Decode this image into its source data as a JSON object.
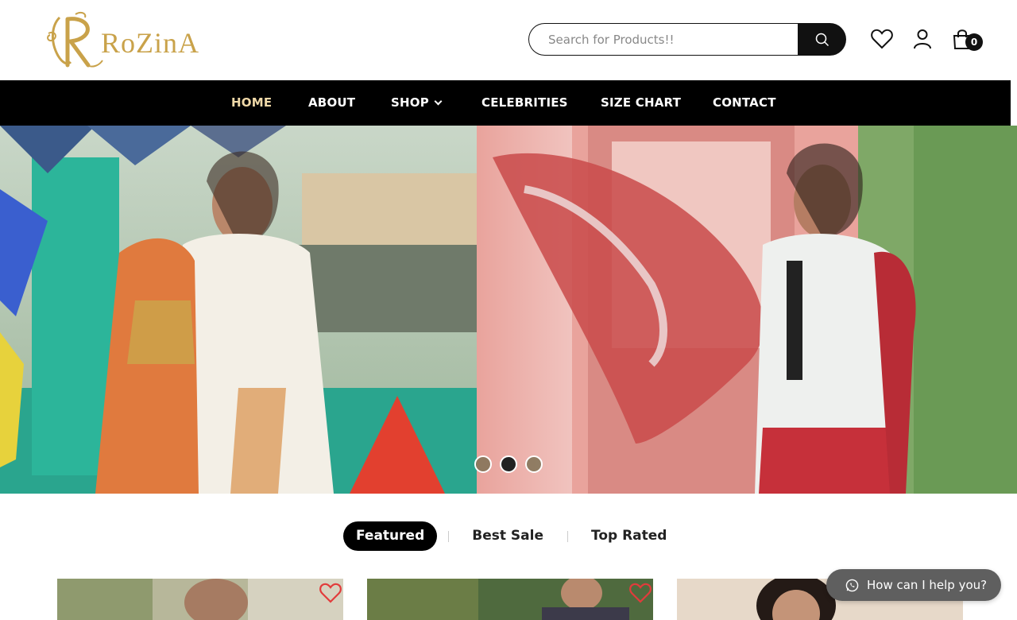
{
  "brand": {
    "name": "RoZinA",
    "accent": "#c9a24a"
  },
  "search": {
    "placeholder": "Search for Products!!"
  },
  "header": {
    "cart_count": "0",
    "icons": [
      "heart-icon",
      "user-icon",
      "bag-icon"
    ]
  },
  "nav": {
    "items": [
      "HOME",
      "ABOUT",
      "SHOP",
      "CELEBRITIES",
      "SIZE CHART",
      "CONTACT"
    ],
    "active": "HOME",
    "active_color": "#f0d9a8"
  },
  "hero": {
    "slides": 3,
    "active_slide": 2
  },
  "tabs": {
    "items": [
      "Featured",
      "Best Sale",
      "Top Rated"
    ],
    "active": "Featured"
  },
  "chat": {
    "label": "How can I help you?"
  },
  "colors": {
    "nav_bg": "#000000",
    "wishlist_red": "#e23b3b"
  }
}
